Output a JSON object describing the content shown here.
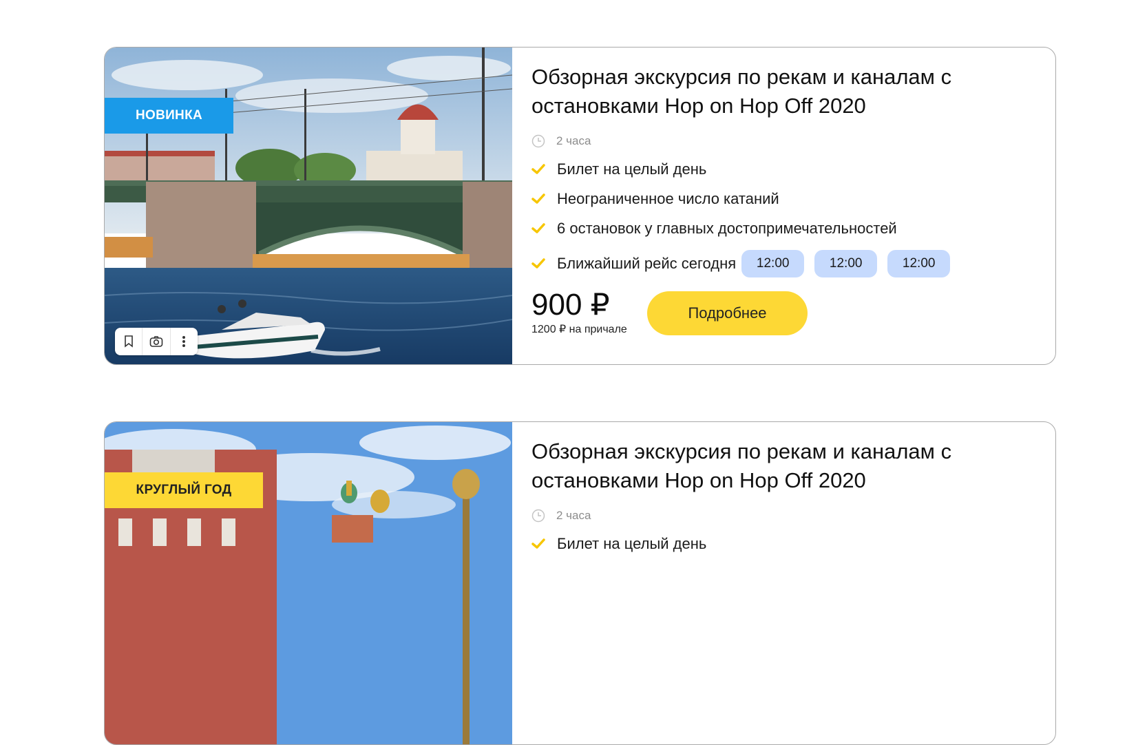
{
  "cards": [
    {
      "badge": "НОВИНКА",
      "badge_color": "#1a9ae8",
      "title": "Обзорная экскурсия по рекам и каналам с остановками Hop on Hop Off 2020",
      "duration": "2 часа",
      "features": [
        "Билет на целый день",
        "Неограниченное число катаний",
        "6 остановок у главных достопримечательностей",
        "Ближайший рейс сегодня"
      ],
      "times": [
        "12:00",
        "12:00",
        "12:00"
      ],
      "price": "900 ₽",
      "price_pier": "1200 ₽ на причале",
      "button": "Подробнее",
      "image_subject": "bridge-boat-photo",
      "tools": [
        "bookmark-icon",
        "lens-icon",
        "more-vertical-icon"
      ]
    },
    {
      "badge": "КРУГЛЫЙ ГОД",
      "badge_color": "#fdd835",
      "title": "Обзорная экскурсия по рекам и каналам с остановками Hop on Hop Off 2020",
      "duration": "2 часа",
      "features": [
        "Билет на целый день"
      ],
      "image_subject": "cathedral-photo"
    }
  ],
  "colors": {
    "accent_yellow": "#fdd835",
    "time_chip": "#c6dafd",
    "check": "#f7c600",
    "badge_blue": "#1a9ae8"
  }
}
